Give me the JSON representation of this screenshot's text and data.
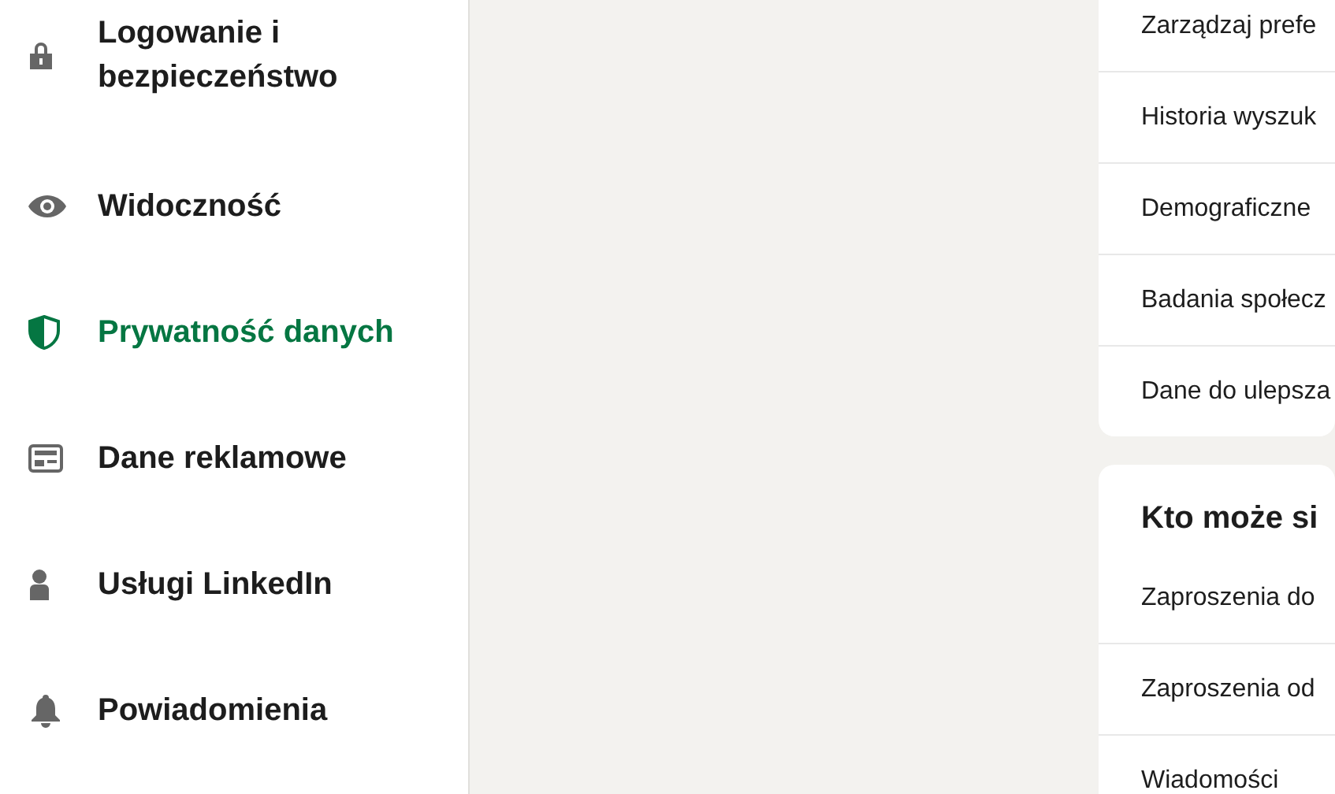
{
  "sidebar": {
    "items": [
      {
        "label": "Logowanie i bezpieczeństwo",
        "selected": false
      },
      {
        "label": "Widoczność",
        "selected": false
      },
      {
        "label": "Prywatność danych",
        "selected": true
      },
      {
        "label": "Dane reklamowe",
        "selected": false
      },
      {
        "label": "Usługi LinkedIn",
        "selected": false
      },
      {
        "label": "Powiadomienia",
        "selected": false
      }
    ]
  },
  "cards": [
    {
      "rows": [
        "Zarządzaj prefe",
        "Historia wyszuk",
        "Demograficzne",
        "Badania społecz",
        "Dane do ulepsza"
      ]
    },
    {
      "title": "Kto może si",
      "rows": [
        "Zaproszenia do",
        "Zaproszenia od",
        "Wiadomości"
      ]
    }
  ]
}
